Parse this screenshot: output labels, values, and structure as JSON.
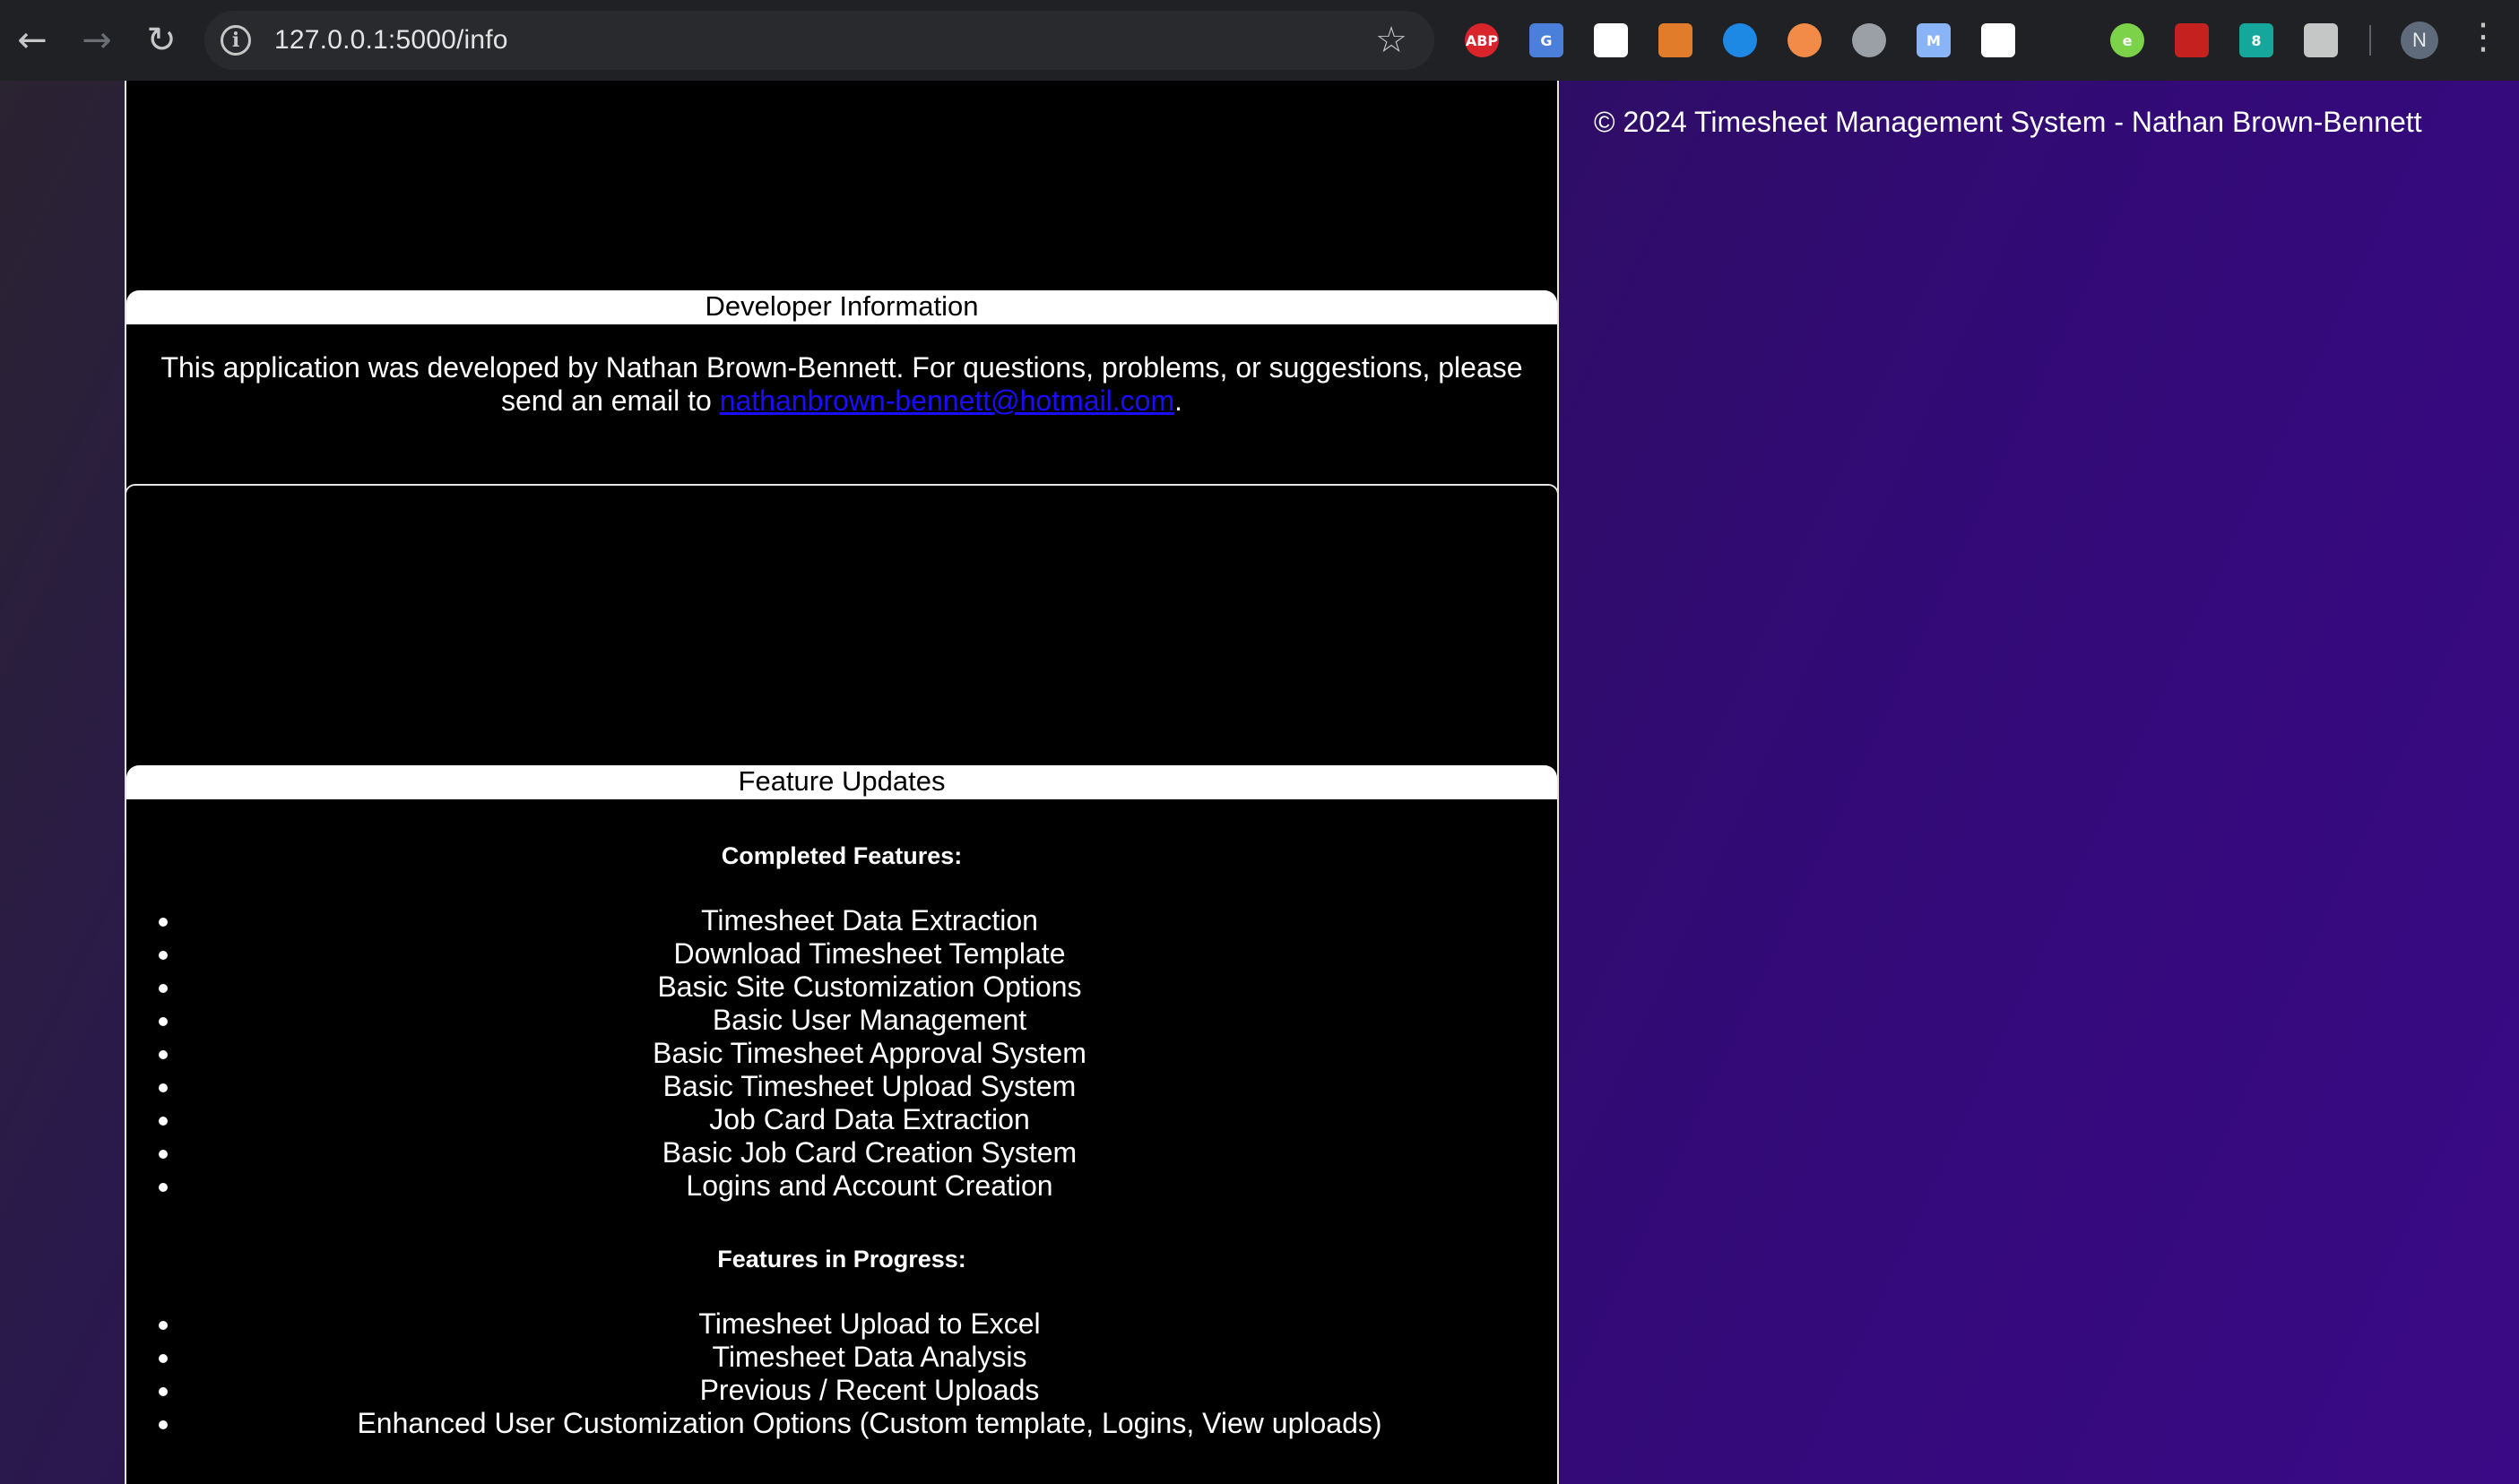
{
  "browser": {
    "url": "127.0.0.1:5000/info",
    "extensions": [
      {
        "name": "adblock-plus-icon",
        "label": "ABP",
        "color": "#d9242c"
      },
      {
        "name": "google-translate-icon",
        "label": "G",
        "color": "#4a80d9"
      },
      {
        "name": "cursor-tool-icon",
        "label": "",
        "color": "#ffffff"
      },
      {
        "name": "window-tool-icon",
        "label": "",
        "color": "#e07c2a"
      },
      {
        "name": "edge-icon",
        "label": "",
        "color": "#1e88e5"
      },
      {
        "name": "capsule-icon",
        "label": "",
        "color": "#f28b48"
      },
      {
        "name": "target-icon",
        "label": "",
        "color": "#9aa0a6"
      },
      {
        "name": "m-extension-icon",
        "label": "M",
        "color": "#8ab4f8"
      },
      {
        "name": "picture-in-picture-icon",
        "label": "",
        "color": "#ffffff"
      },
      {
        "name": "bell-icon",
        "label": "",
        "color": "#202124"
      },
      {
        "name": "e-extension-icon",
        "label": "e",
        "color": "#7cd34a"
      },
      {
        "name": "pdf-icon",
        "label": "",
        "color": "#c5221f"
      },
      {
        "name": "teal-extension-icon",
        "label": "8",
        "color": "#16a79c"
      },
      {
        "name": "puzzle-icon",
        "label": "",
        "color": "#c4c7c5"
      }
    ],
    "avatar_initial": "N"
  },
  "footer": {
    "copyright": "© 2024 Timesheet Management System - Nathan Brown-Bennett"
  },
  "developer_card": {
    "title": "Developer Information",
    "text_before": "This application was developed by Nathan Brown-Bennett. For questions, problems, or suggestions, please send an email to ",
    "email": "nathanbrown-bennett@hotmail.com",
    "text_after": "."
  },
  "features_card": {
    "title": "Feature Updates",
    "completed_heading": "Completed Features:",
    "completed": [
      "Timesheet Data Extraction",
      "Download Timesheet Template",
      "Basic Site Customization Options",
      "Basic User Management",
      "Basic Timesheet Approval System",
      "Basic Timesheet Upload System",
      "Job Card Data Extraction",
      "Basic Job Card Creation System",
      "Logins and Account Creation"
    ],
    "in_progress_heading": "Features in Progress:",
    "in_progress": [
      "Timesheet Upload to Excel",
      "Timesheet Data Analysis",
      "Previous / Recent Uploads",
      "Enhanced User Customization Options (Custom template, Logins, View uploads)"
    ]
  }
}
